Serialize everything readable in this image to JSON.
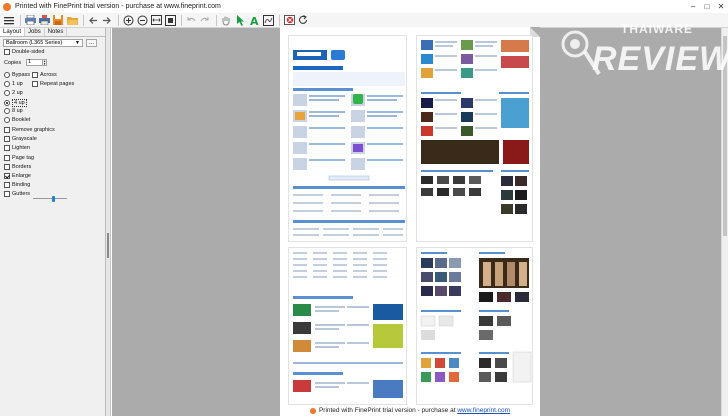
{
  "window": {
    "title": "Printed with FinePrint trial version - purchase at www.fineprint.com",
    "controls": [
      "minimize-icon",
      "maximize-icon",
      "close-icon"
    ]
  },
  "toolbar": {
    "icons": [
      "menu-icon",
      "print-icon",
      "printer-icon",
      "save-icon",
      "open-folder-icon",
      "back-arrow-icon",
      "forward-arrow-icon",
      "zoom-in-icon",
      "zoom-out-icon",
      "zoom-width-icon",
      "fit-page-icon",
      "undo-icon",
      "redo-icon",
      "hand-icon",
      "select-arrow-icon",
      "text-icon",
      "signature-icon",
      "delete-page-icon",
      "refresh-icon"
    ]
  },
  "sidebar": {
    "tabs": [
      "Layout",
      "Jobs",
      "Notes"
    ],
    "printer_name": "Ballroom (L365 Series)",
    "more_button": "...",
    "double_sided": "Double-sided",
    "copies_label": "Copies",
    "copies_value": "1",
    "layouts": [
      "Bypass",
      "1 up",
      "2 up",
      "4 up",
      "8 up",
      "Booklet"
    ],
    "selected_layout": "4 up",
    "across": "Across",
    "repeat_pages": "Repeat pages",
    "options": [
      "Remove graphics",
      "Grayscale",
      "Lighten",
      "Page tag",
      "Borders",
      "Enlarge",
      "Binding",
      "Gutters"
    ],
    "checked_options": [
      "Enlarge"
    ]
  },
  "preview": {
    "footer_prefix": "Printed with FinePrint trial version - purchase at",
    "footer_link": "www.fineprint.com"
  },
  "watermark": {
    "small": "THAIWARE",
    "big": "REVIEW"
  },
  "colors": {
    "accent_blue": "#2a7bd5",
    "fineprint_orange": "#f0762a",
    "preview_gray": "#ababab"
  }
}
